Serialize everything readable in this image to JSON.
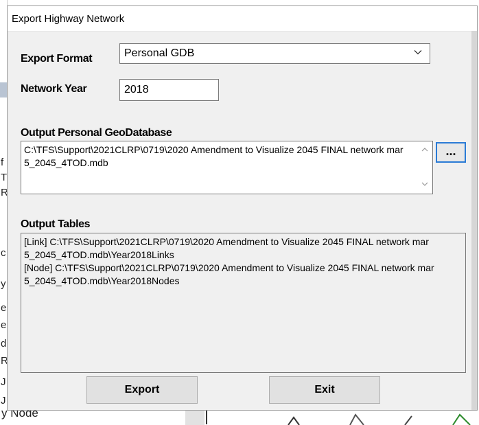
{
  "dialog": {
    "title": "Export Highway Network",
    "export_format_label": "Export Format",
    "export_format_value": "Personal GDB",
    "network_year_label": "Network Year",
    "network_year_value": "2018",
    "output_gdb_label": "Output Personal GeoDatabase",
    "output_gdb_path": "C:\\TFS\\Support\\2021CLRP\\0719\\2020 Amendment to Visualize 2045 FINAL network mar 5_2045_4TOD.mdb",
    "browse_label": "...",
    "output_tables_label": "Output Tables",
    "output_tables": [
      "[Link] C:\\TFS\\Support\\2021CLRP\\0719\\2020 Amendment to Visualize 2045 FINAL network mar 5_2045_4TOD.mdb\\Year2018Links",
      "[Node] C:\\TFS\\Support\\2021CLRP\\0719\\2020 Amendment to Visualize 2045 FINAL network mar 5_2045_4TOD.mdb\\Year2018Nodes"
    ],
    "export_button": "Export",
    "exit_button": "Exit"
  },
  "background": {
    "left_fragments": [
      "f",
      "T",
      "R",
      "c",
      "y",
      "e",
      "e",
      "d",
      "R",
      "J",
      "J"
    ],
    "bottom_text": "y Node"
  }
}
